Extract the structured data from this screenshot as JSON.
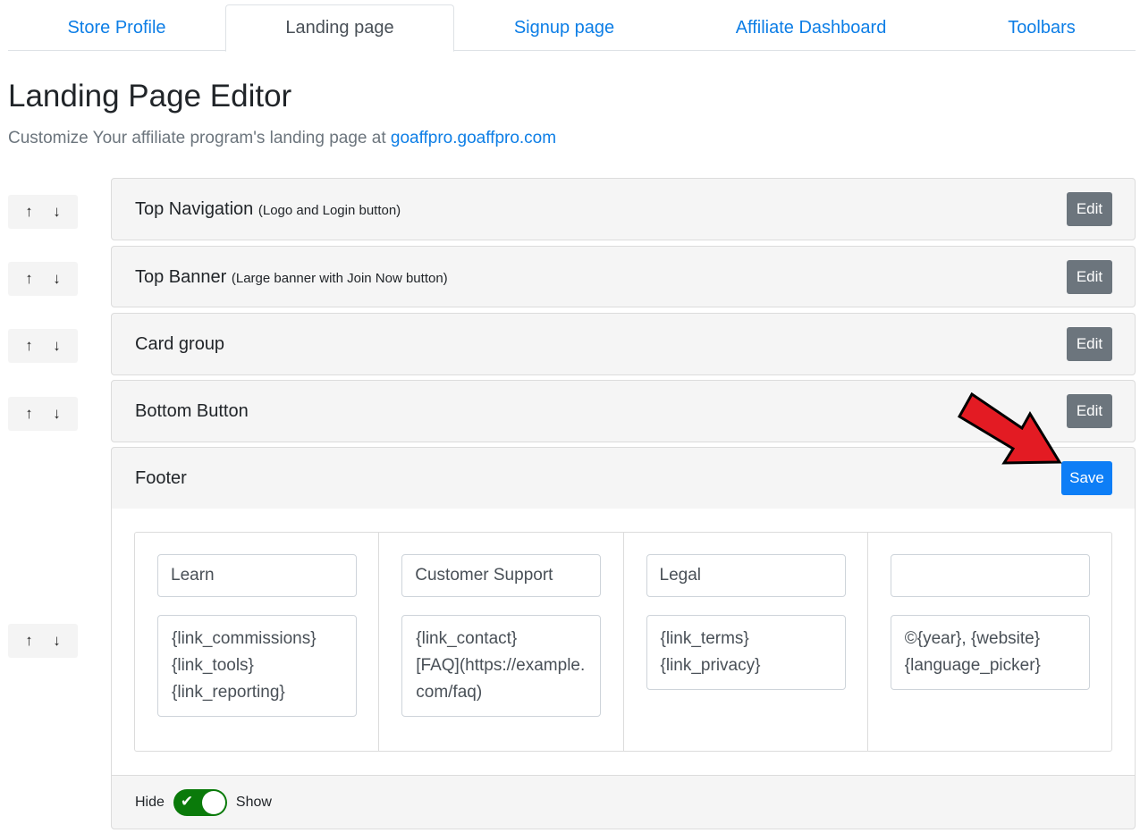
{
  "tabs": [
    {
      "label": "Store Profile",
      "active": false
    },
    {
      "label": "Landing page",
      "active": true
    },
    {
      "label": "Signup page",
      "active": false
    },
    {
      "label": "Affiliate Dashboard",
      "active": false
    },
    {
      "label": "Toolbars",
      "active": false
    }
  ],
  "header": {
    "title": "Landing Page Editor",
    "subtitle_prefix": "Customize Your affiliate program's landing page at ",
    "subtitle_link": "goaffpro.goaffpro.com"
  },
  "mover": {
    "up_icon": "↑",
    "down_icon": "↓"
  },
  "sections": [
    {
      "title": "Top Navigation",
      "note": "(Logo and Login button)",
      "button": "Edit"
    },
    {
      "title": "Top Banner",
      "note": "(Large banner with Join Now button)",
      "button": "Edit"
    },
    {
      "title": "Card group",
      "note": "",
      "button": "Edit"
    },
    {
      "title": "Bottom Button",
      "note": "",
      "button": "Edit"
    }
  ],
  "footer": {
    "title": "Footer",
    "save_label": "Save",
    "columns": [
      {
        "heading": "Learn",
        "content": "{link_commissions}\n{link_tools}\n{link_reporting}"
      },
      {
        "heading": "Customer Support",
        "content": "{link_contact}\n[FAQ](https://example.com/faq)"
      },
      {
        "heading": "Legal",
        "content": "{link_terms}\n{link_privacy}"
      },
      {
        "heading": "",
        "content": "©{year}, {website}\n{language_picker}"
      }
    ],
    "toggle": {
      "hide_label": "Hide",
      "show_label": "Show",
      "state": "Show"
    }
  },
  "colors": {
    "accent": "#0d7ef6",
    "toggle_on": "#0a7a0a",
    "annotation_arrow": "#e31b23"
  }
}
